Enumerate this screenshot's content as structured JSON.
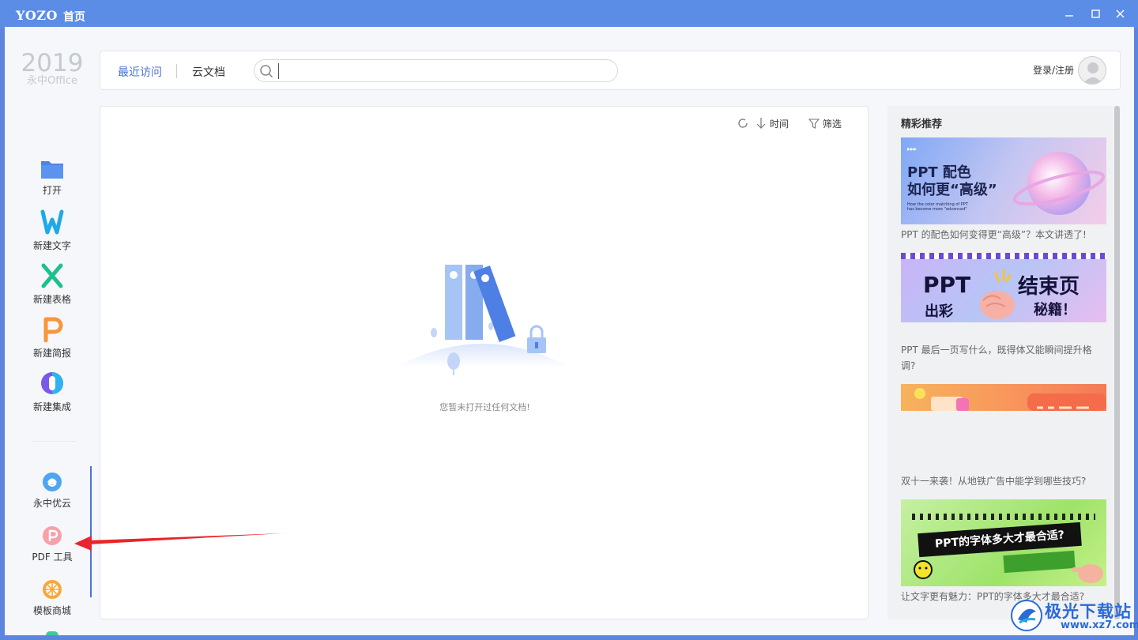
{
  "titlebar": {
    "logo": "YOZO",
    "title": "首页"
  },
  "brand": {
    "year": "2019",
    "name": "永中Office"
  },
  "sidebar": {
    "items": [
      {
        "label": "打开"
      },
      {
        "label": "新建文字"
      },
      {
        "label": "新建表格"
      },
      {
        "label": "新建简报"
      },
      {
        "label": "新建集成"
      },
      {
        "label": "永中优云"
      },
      {
        "label": "PDF 工具"
      },
      {
        "label": "模板商城"
      }
    ]
  },
  "topbar": {
    "tabs": [
      {
        "label": "最近访问"
      },
      {
        "label": "云文档"
      }
    ],
    "search": {
      "placeholder": "",
      "value": ""
    },
    "login_label": "登录/注册"
  },
  "main": {
    "sort_label": "时间",
    "filter_label": "筛选",
    "empty_text": "您暂未打开过任何文档!"
  },
  "recommend": {
    "title": "精彩推荐",
    "cards": [
      {
        "image_title_1": "PPT 配色",
        "image_title_2": "如何更“高级”",
        "image_sub": "How the color matching of PPT has become more \"advanced\"",
        "caption": "PPT 的配色如何变得更“高级”？本文讲透了!"
      },
      {
        "image_left": "PPT",
        "image_left2": "出彩",
        "image_right": "结束页",
        "image_right2": "秘籍！",
        "caption": "PPT 最后一页写什么，既得体又能瞬间提升格调?"
      },
      {
        "caption": "双十一来袭！从地铁广告中能学到哪些技巧?"
      },
      {
        "image_text": "PPT的字体多大才最合适?",
        "caption": "让文字更有魅力：PPT的字体多大才最合适?"
      }
    ]
  },
  "watermark": {
    "text": "极光下载站",
    "url": "www.xz7.com"
  },
  "colors": {
    "titlebar": "#5b8ce6",
    "accent": "#4a72d4",
    "arrow": "#e8252a"
  }
}
